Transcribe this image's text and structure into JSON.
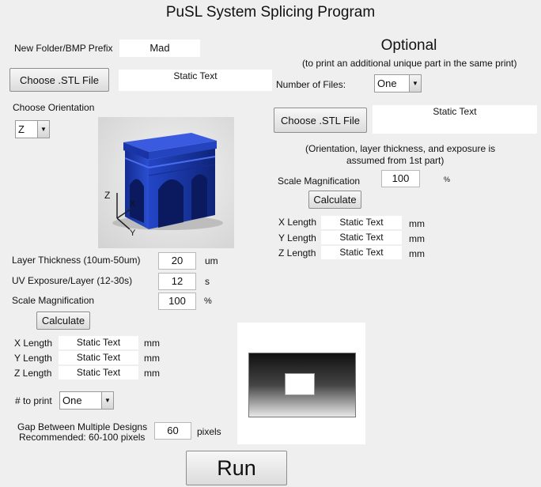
{
  "title": "PuSL System Splicing Program",
  "left": {
    "prefix_label": "New Folder/BMP Prefix",
    "prefix_value": "Mad",
    "choose_stl_label": "Choose .STL File",
    "stl_status": "Static Text",
    "orientation_label": "Choose Orientation",
    "orientation_value": "Z",
    "axis_labels": {
      "z": "Z",
      "x": "X",
      "y": "Y"
    },
    "layer_label": "Layer Thickness (10um-50um)",
    "layer_value": "20",
    "layer_unit": "um",
    "uv_label": "UV Exposure/Layer (12-30s)",
    "uv_value": "12",
    "uv_unit": "s",
    "scale_label": "Scale Magnification",
    "scale_value": "100",
    "scale_unit": "%",
    "calculate_label": "Calculate",
    "x_label": "X Length",
    "y_label": "Y Length",
    "z_label": "Z Length",
    "x_value": "Static Text",
    "y_value": "Static Text",
    "z_value": "Static Text",
    "mm": "mm",
    "to_print_label": "# to print",
    "to_print_value": "One",
    "gap_label_1": "Gap Between Multiple Designs",
    "gap_label_2": "Recommended: 60-100 pixels",
    "gap_value": "60",
    "gap_unit": "pixels"
  },
  "right": {
    "optional_title": "Optional",
    "optional_subtitle": "(to print an additional unique part in the same print)",
    "num_files_label": "Number of Files:",
    "num_files_value": "One",
    "choose_stl_label": "Choose .STL File",
    "stl_status": "Static Text",
    "note_1": "(Orientation, layer thickness, and exposure is",
    "note_2": "assumed from 1st part)",
    "scale_label": "Scale Magnification",
    "scale_value": "100",
    "scale_unit": "%",
    "calculate_label": "Calculate",
    "x_label": "X Length",
    "y_label": "Y Length",
    "z_label": "Z Length",
    "x_value": "Static Text",
    "y_value": "Static Text",
    "z_value": "Static Text",
    "mm": "mm"
  },
  "run_label": "Run",
  "colors": {
    "model_blue": "#1f3fb8",
    "background": "#efefef"
  }
}
